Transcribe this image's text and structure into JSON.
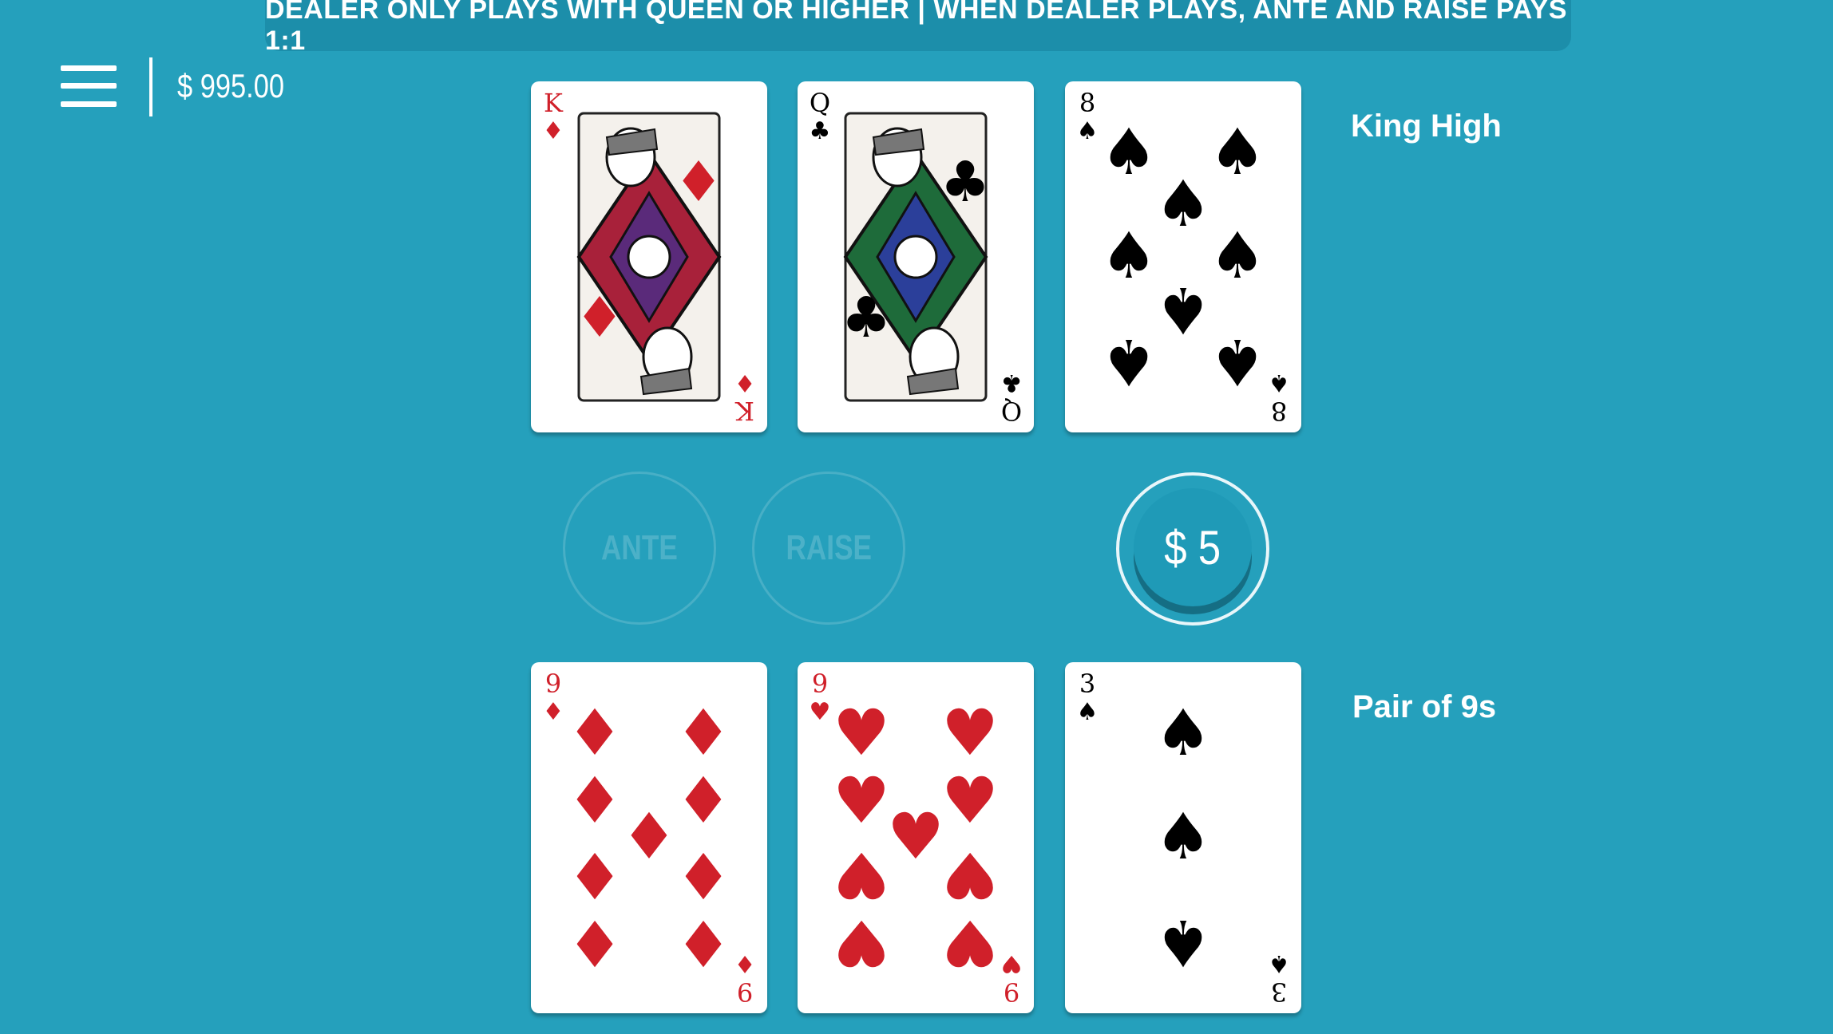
{
  "banner": {
    "text": "DEALER ONLY PLAYS WITH QUEEN OR HIGHER | WHEN DEALER PLAYS, ANTE AND RAISE PAYS 1:1"
  },
  "header": {
    "menu_icon": "hamburger-menu-icon",
    "balance": "$ 995.00"
  },
  "dealer": {
    "hand_label": "King High",
    "cards": [
      {
        "rank": "K",
        "suit": "diamonds",
        "suit_symbol": "♦",
        "color": "#d0202a"
      },
      {
        "rank": "Q",
        "suit": "clubs",
        "suit_symbol": "♣",
        "color": "#000000"
      },
      {
        "rank": "8",
        "suit": "spades",
        "suit_symbol": "♠",
        "color": "#000000"
      }
    ]
  },
  "player": {
    "hand_label": "Pair of 9s",
    "cards": [
      {
        "rank": "9",
        "suit": "diamonds",
        "suit_symbol": "♦",
        "color": "#d0202a"
      },
      {
        "rank": "9",
        "suit": "hearts",
        "suit_symbol": "♥",
        "color": "#d0202a"
      },
      {
        "rank": "3",
        "suit": "spades",
        "suit_symbol": "♠",
        "color": "#000000"
      }
    ]
  },
  "bets": {
    "ante_label": "ANTE",
    "raise_label": "RAISE",
    "chip_label": "$ 5"
  },
  "colors": {
    "table": "#25a0bc",
    "banner": "#1c8eaa",
    "red_suit": "#d0202a",
    "chip": "#1f9ab7"
  }
}
